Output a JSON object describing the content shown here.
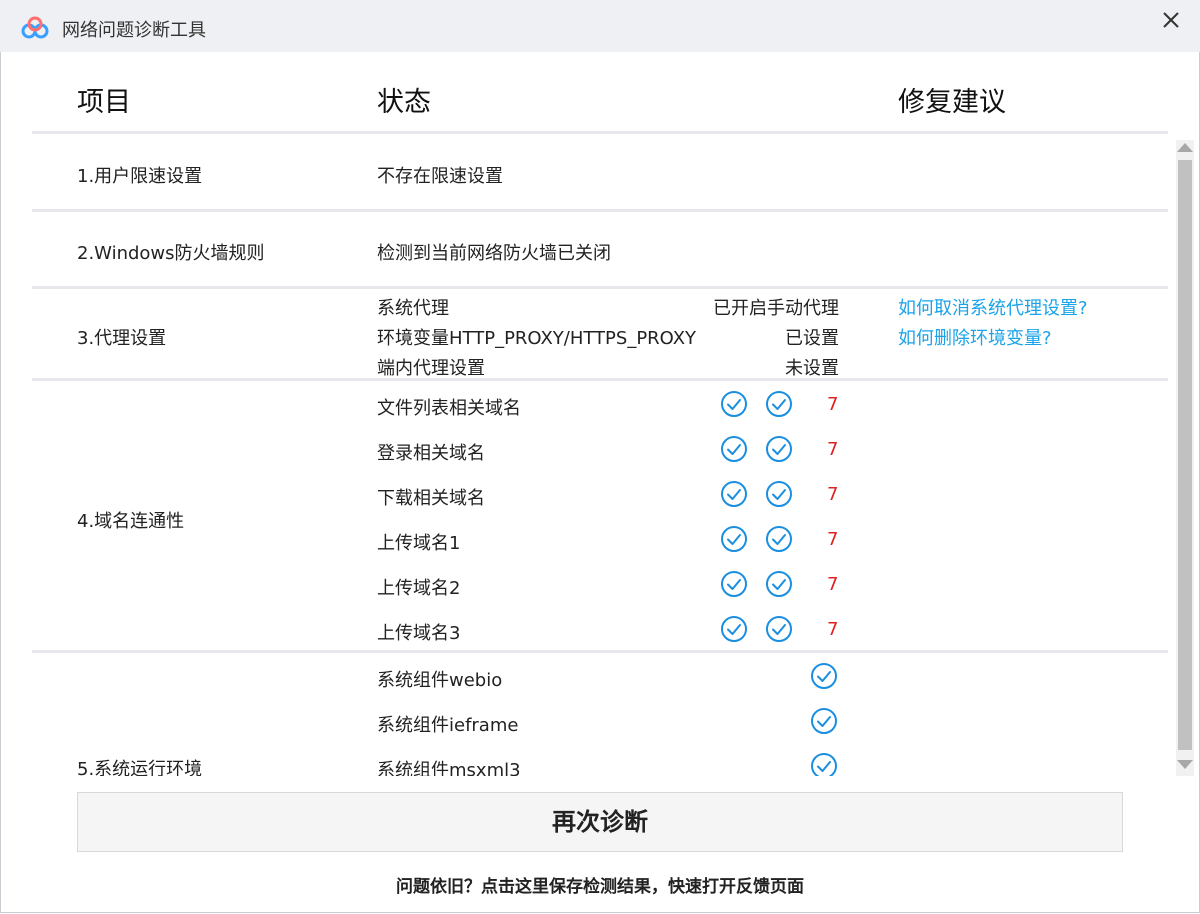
{
  "window": {
    "title": "网络问题诊断工具"
  },
  "header": {
    "col_item": "项目",
    "col_status": "状态",
    "col_fix": "修复建议"
  },
  "rows": {
    "r1": {
      "item": "1.用户限速设置",
      "status": "不存在限速设置"
    },
    "r2": {
      "item": "2.Windows防火墙规则",
      "status": "检测到当前网络防火墙已关闭"
    },
    "r3": {
      "item": "3.代理设置",
      "entries": [
        {
          "label": "系统代理",
          "value": "已开启手动代理",
          "fix": "如何取消系统代理设置?"
        },
        {
          "label": "环境变量HTTP_PROXY/HTTPS_PROXY",
          "value": "已设置",
          "fix": "如何删除环境变量?"
        },
        {
          "label": "端内代理设置",
          "value": "未设置"
        }
      ]
    },
    "r4": {
      "item": "4.域名连通性",
      "domains": [
        {
          "label": "文件列表相关域名",
          "count": "7"
        },
        {
          "label": "登录相关域名",
          "count": "7"
        },
        {
          "label": "下载相关域名",
          "count": "7"
        },
        {
          "label": "上传域名1",
          "count": "7"
        },
        {
          "label": "上传域名2",
          "count": "7"
        },
        {
          "label": "上传域名3",
          "count": "7"
        }
      ]
    },
    "r5": {
      "item": "5.系统运行环境",
      "components": [
        {
          "label": "系统组件webio"
        },
        {
          "label": "系统组件ieframe"
        },
        {
          "label": "系统组件msxml3"
        }
      ]
    }
  },
  "actions": {
    "rediagnose": "再次诊断",
    "feedback": "问题依旧？点击这里保存检测结果，快速打开反馈页面"
  },
  "colors": {
    "accent": "#1aa3e8",
    "check": "#1a8fe0",
    "count": "#e02020"
  }
}
